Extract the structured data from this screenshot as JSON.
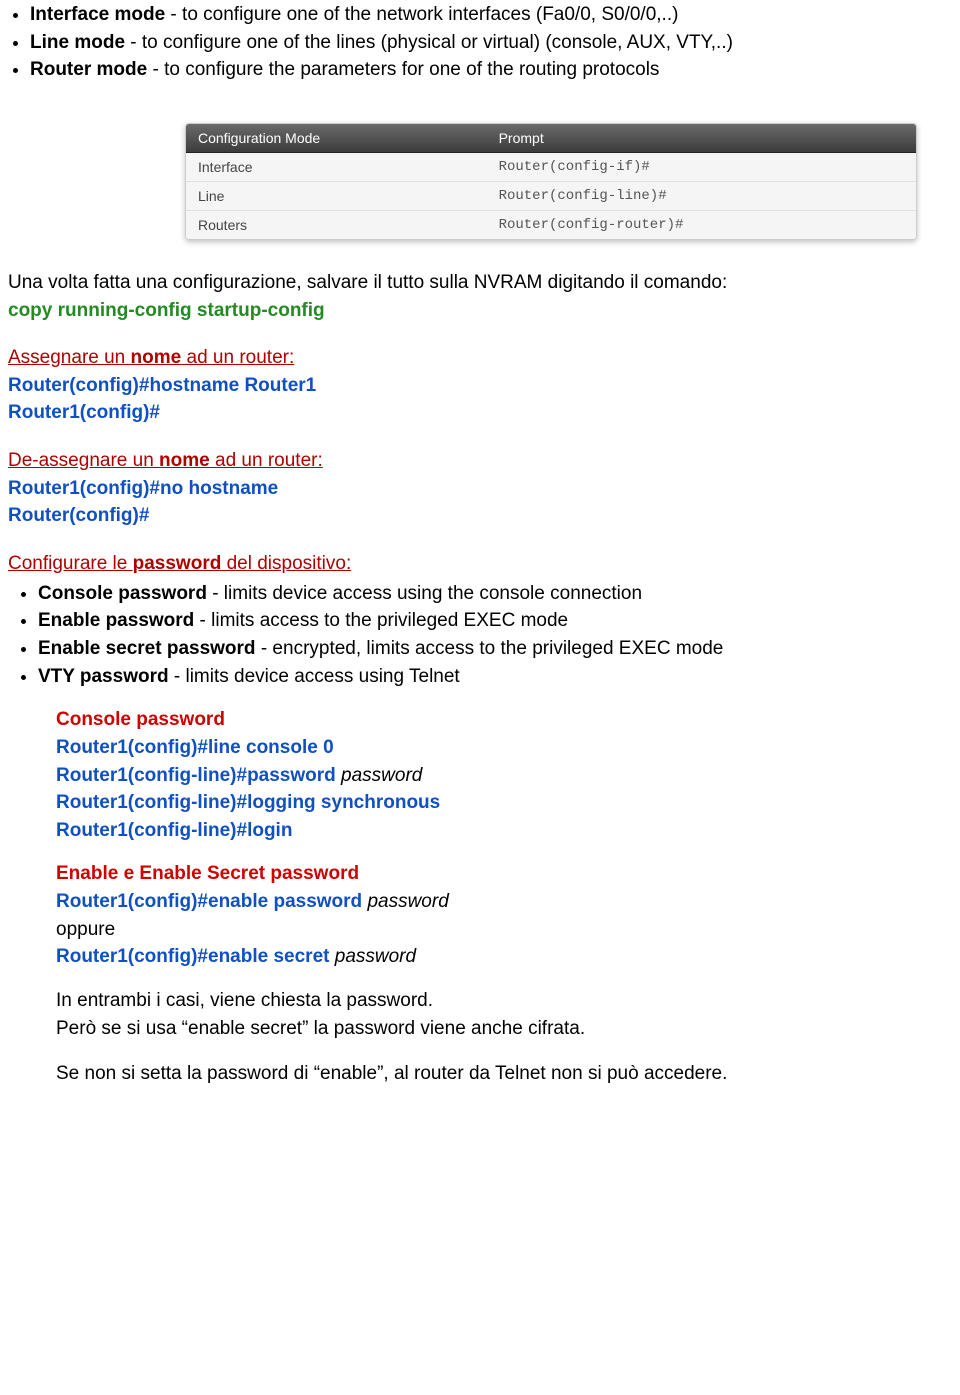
{
  "top_bullets": [
    {
      "bold": "Interface mode",
      "rest": " - to configure one of the network interfaces (Fa0/0, S0/0/0,..)"
    },
    {
      "bold": "Line mode",
      "rest": " - to configure one of the lines (physical or virtual) (console, AUX, VTY,..)"
    },
    {
      "bold": "Router mode",
      "rest": " - to configure the parameters for one of the routing protocols"
    }
  ],
  "table": {
    "headers": [
      "Configuration Mode",
      "Prompt"
    ],
    "rows": [
      [
        "Interface",
        "Router(config-if)#"
      ],
      [
        "Line",
        "Router(config-line)#"
      ],
      [
        "Routers",
        "Router(config-router)#"
      ]
    ]
  },
  "para1": "Una volta fatta una configurazione, salvare il tutto sulla NVRAM digitando il comando:",
  "copy_cmd": "copy running-config startup-config",
  "assign_title_pre": "Assegnare un ",
  "assign_title_bold": "nome",
  "assign_title_post": " ad un router:",
  "assign_line1_prompt": "Router(config)#",
  "assign_line1_cmd": "hostname Router1",
  "assign_line2": "Router1(config)#",
  "deassign_title_pre": "De-assegnare un ",
  "deassign_title_bold": "nome",
  "deassign_title_post": " ad un router:",
  "deassign_line1_prompt": "Router1(config)#",
  "deassign_line1_cmd": "no hostname",
  "deassign_line2": "Router(config)#",
  "conf_pwd_pre": "Configurare le ",
  "conf_pwd_bold": "password",
  "conf_pwd_post": " del dispositivo:",
  "pwd_bullets": [
    {
      "bold": "Console password",
      "rest": " - limits device access using the console connection"
    },
    {
      "bold": "Enable password",
      "rest": " - limits access to the privileged EXEC mode"
    },
    {
      "bold": "Enable secret password",
      "rest": " - encrypted, limits access to the privileged EXEC mode"
    },
    {
      "bold": "VTY password",
      "rest": " - limits device access using Telnet"
    }
  ],
  "console": {
    "title": "Console password",
    "l1p": "Router1(config)#",
    "l1c": "line console 0",
    "l2p": "Router1(config-line)#",
    "l2c": "password",
    "l2arg": " password",
    "l3p": "Router1(config-line)#",
    "l3c": "logging synchronous",
    "l4p": "Router1(config-line)#",
    "l4c": "login"
  },
  "enable": {
    "title": "Enable e Enable Secret password",
    "l1p": "Router1(config)#",
    "l1c": "enable password",
    "l1arg": " password",
    "oppure": "oppure",
    "l2p": "Router1(config)#",
    "l2c": "enable secret",
    "l2arg": " password"
  },
  "note1": "In entrambi i casi, viene chiesta la password.",
  "note2": "Però se si usa “enable secret” la password viene anche cifrata.",
  "note3": "Se non si setta la password di “enable”, al router da Telnet non si può accedere."
}
